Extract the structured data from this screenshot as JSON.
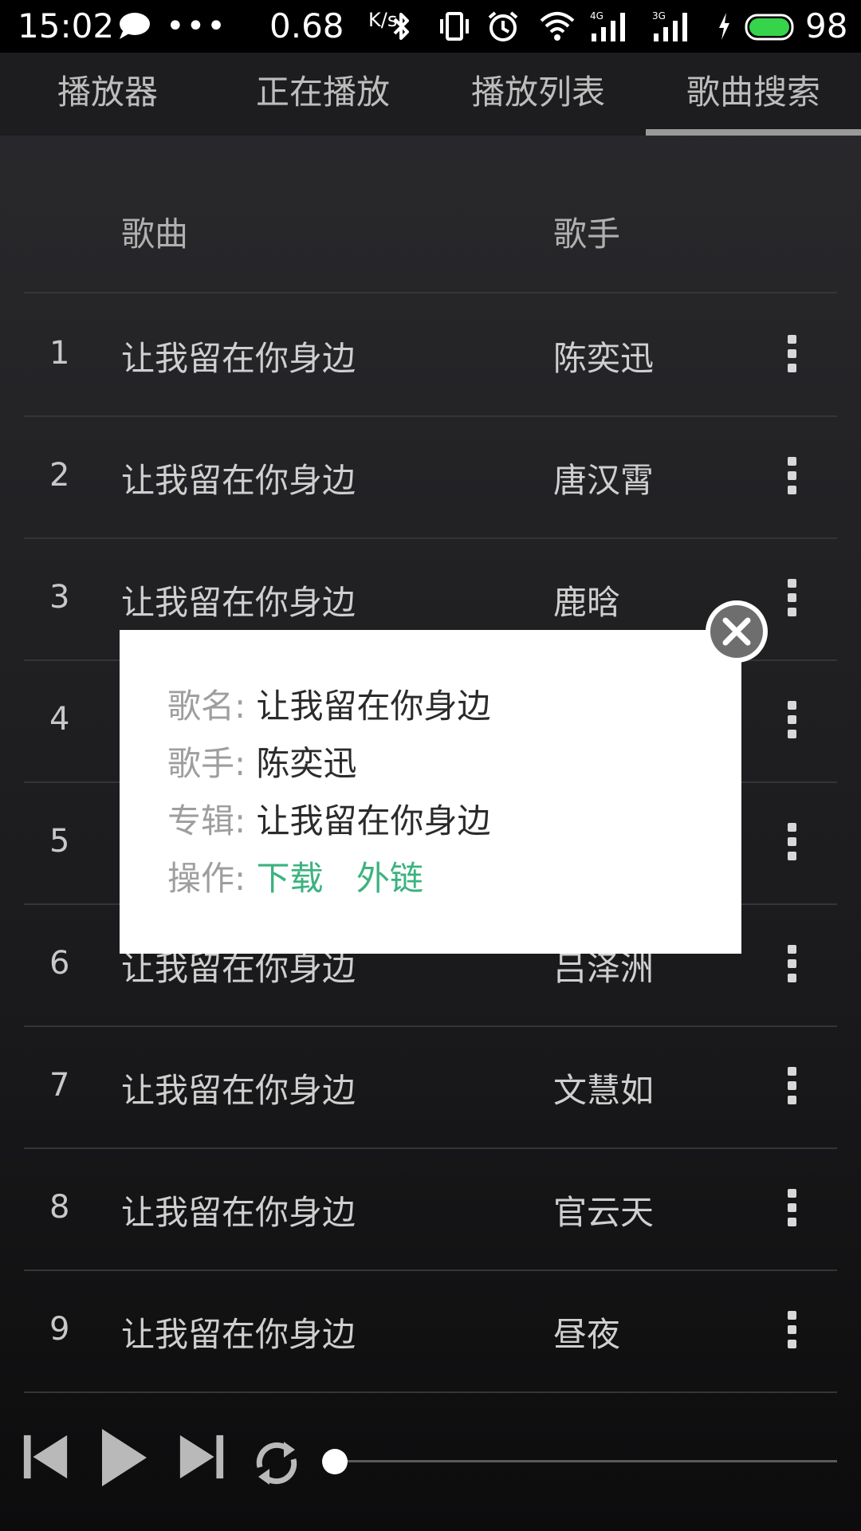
{
  "status_bar": {
    "time": "15:02",
    "dots": "•••",
    "speed": "0.68",
    "speed_unit": "K/s",
    "battery": "98",
    "icons": [
      "chat-bubble-icon",
      "bluetooth-icon",
      "vibrate-icon",
      "alarm-icon",
      "wifi-icon",
      "signal-4g-icon",
      "signal-3g-icon",
      "charging-icon",
      "battery-icon"
    ]
  },
  "tabs": [
    {
      "label": "播放器"
    },
    {
      "label": "正在播放"
    },
    {
      "label": "播放列表"
    },
    {
      "label": "歌曲搜索",
      "active": true
    }
  ],
  "list_header": {
    "song": "歌曲",
    "artist": "歌手"
  },
  "rows": [
    {
      "num": "1",
      "song": "让我留在你身边",
      "artist": "陈奕迅"
    },
    {
      "num": "2",
      "song": "让我留在你身边",
      "artist": "唐汉霄"
    },
    {
      "num": "3",
      "song": "让我留在你身边",
      "artist": "鹿晗"
    },
    {
      "num": "4",
      "song": "",
      "artist": ""
    },
    {
      "num": "5",
      "song": "",
      "artist": ""
    },
    {
      "num": "6",
      "song": "让我留在你身边",
      "artist": "吕泽洲"
    },
    {
      "num": "7",
      "song": "让我留在你身边",
      "artist": "文慧如"
    },
    {
      "num": "8",
      "song": "让我留在你身边",
      "artist": "官云天"
    },
    {
      "num": "9",
      "song": "让我留在你身边",
      "artist": "昼夜"
    }
  ],
  "dialog": {
    "song_label": "歌名:",
    "song_value": "让我留在你身边",
    "artist_label": "歌手:",
    "artist_value": "陈奕迅",
    "album_label": "专辑:",
    "album_value": "让我留在你身边",
    "action_label": "操作:",
    "download": "下载",
    "external_link": "外链"
  },
  "player": {
    "progress": 0.0,
    "icons": [
      "previous-icon",
      "play-icon",
      "next-icon",
      "repeat-icon"
    ]
  },
  "colors": {
    "accent_green": "#3bb37f",
    "background": "#1d1d1f",
    "dialog_bg": "#ffffff"
  }
}
